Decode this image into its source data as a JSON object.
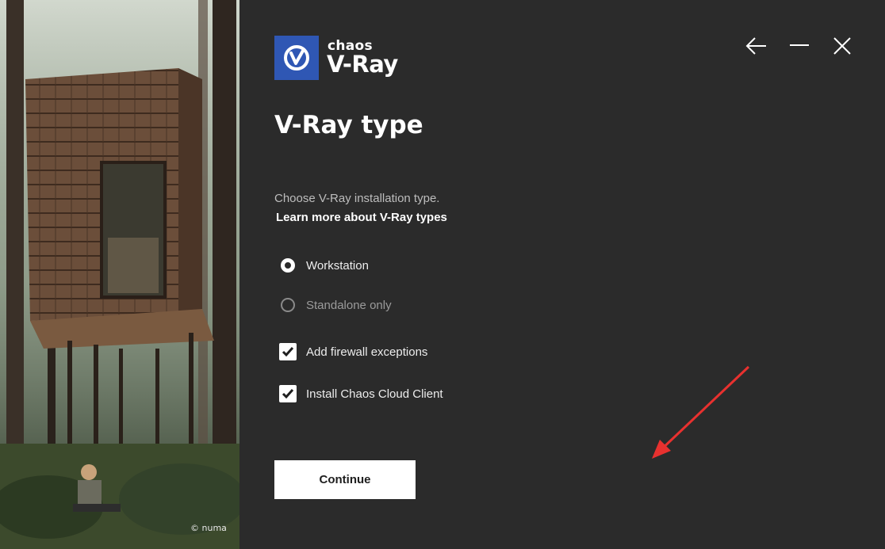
{
  "hero": {
    "credit": "© numa"
  },
  "brand": {
    "company": "chaos",
    "product": "V-Ray",
    "accent": "#2f57b4"
  },
  "window_controls": {
    "back": "back-arrow-icon",
    "minimize": "minimize-icon",
    "close": "close-icon"
  },
  "page": {
    "title": "V-Ray type",
    "description": "Choose V-Ray installation type.",
    "learn_more": "Learn more about V-Ray types"
  },
  "options": {
    "radios": [
      {
        "label": "Workstation",
        "selected": true
      },
      {
        "label": "Standalone only",
        "selected": false
      }
    ],
    "checkboxes": [
      {
        "label": "Add firewall exceptions",
        "checked": true
      },
      {
        "label": "Install Chaos Cloud Client",
        "checked": true
      }
    ]
  },
  "actions": {
    "continue_label": "Continue"
  },
  "annotation": {
    "color": "#e8312f"
  }
}
